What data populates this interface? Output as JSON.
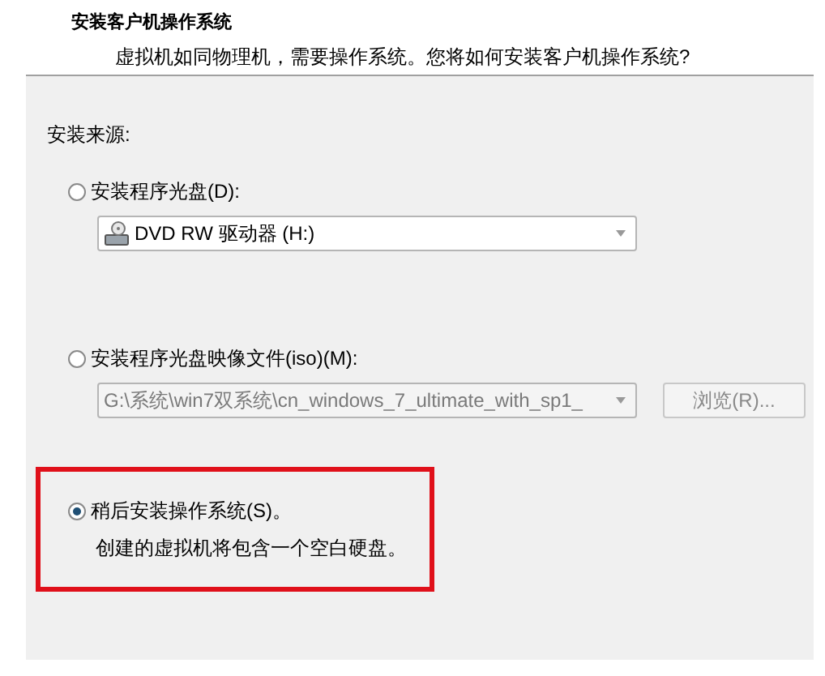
{
  "header": {
    "title": "安装客户机操作系统",
    "subtitle": "虚拟机如同物理机，需要操作系统。您将如何安装客户机操作系统?"
  },
  "source_label": "安装来源:",
  "options": [
    {
      "label": "安装程序光盘(D):",
      "selected": false,
      "highlighted": false,
      "dropdown": {
        "value": "DVD RW 驱动器 (H:)",
        "disabled": false,
        "kind": "drive"
      }
    },
    {
      "label": "安装程序光盘映像文件(iso)(M):",
      "selected": false,
      "highlighted": false,
      "dropdown": {
        "value": "G:\\系统\\win7双系统\\cn_windows_7_ultimate_with_sp1_",
        "disabled": true,
        "kind": "path"
      },
      "browse": {
        "label": "浏览(R)...",
        "disabled": true
      }
    },
    {
      "label": "稍后安装操作系统(S)。",
      "selected": true,
      "highlighted": true,
      "description": "创建的虚拟机将包含一个空白硬盘。"
    }
  ]
}
